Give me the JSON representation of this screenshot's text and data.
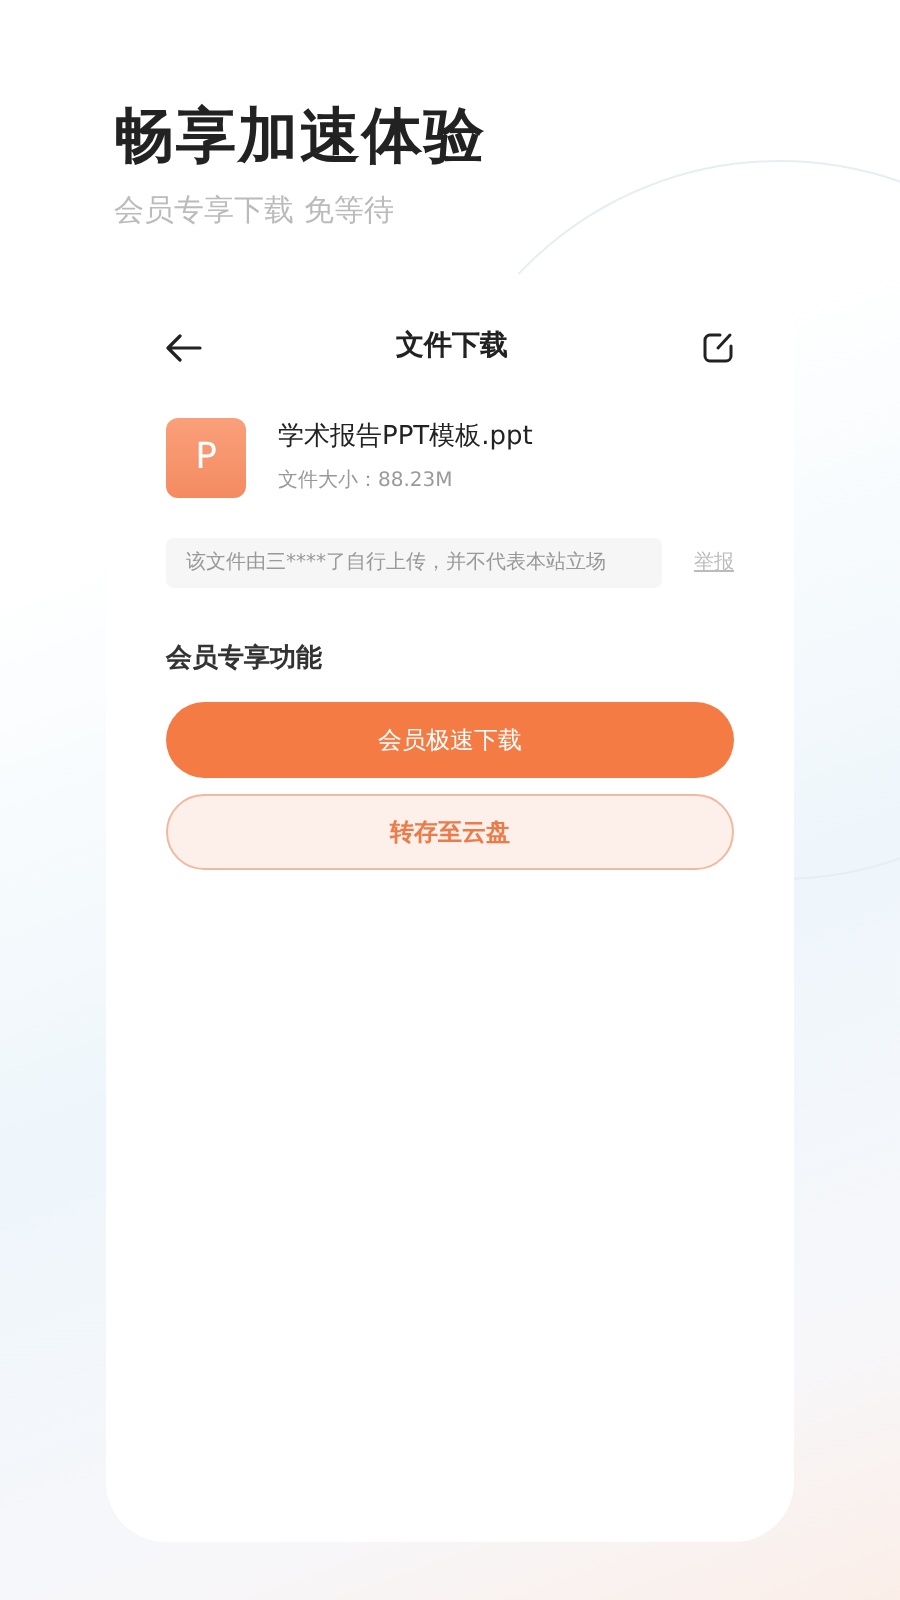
{
  "hero": {
    "title": "畅享加速体验",
    "subtitle": "会员专享下载 免等待"
  },
  "header": {
    "title": "文件下载"
  },
  "file": {
    "type_letter": "P",
    "name": "学术报告PPT模板.ppt",
    "size": "文件大小：88.23M"
  },
  "notice": {
    "text": "该文件由三****了自行上传，并不代表本站立场",
    "report": "举报"
  },
  "section_title": "会员专享功能",
  "buttons": [
    {
      "label": "会员极速下载",
      "kind": "primary"
    },
    {
      "label": "转存至云盘",
      "kind": "outline"
    }
  ]
}
